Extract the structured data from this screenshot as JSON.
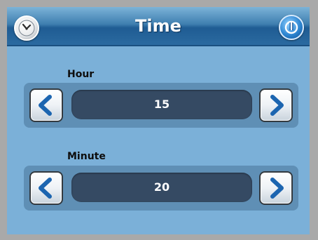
{
  "header": {
    "title": "Time",
    "clock_icon": "clock-icon",
    "power_icon": "power-icon"
  },
  "hour": {
    "label": "Hour",
    "value": "15",
    "decrease_icon": "chevron-left-icon",
    "increase_icon": "chevron-right-icon"
  },
  "minute": {
    "label": "Minute",
    "value": "20",
    "decrease_icon": "chevron-left-icon",
    "increase_icon": "chevron-right-icon"
  },
  "colors": {
    "background": "#7bb0d8",
    "header": "#1f5c93",
    "value_box": "#354a63",
    "arrow": "#1c65b0"
  }
}
